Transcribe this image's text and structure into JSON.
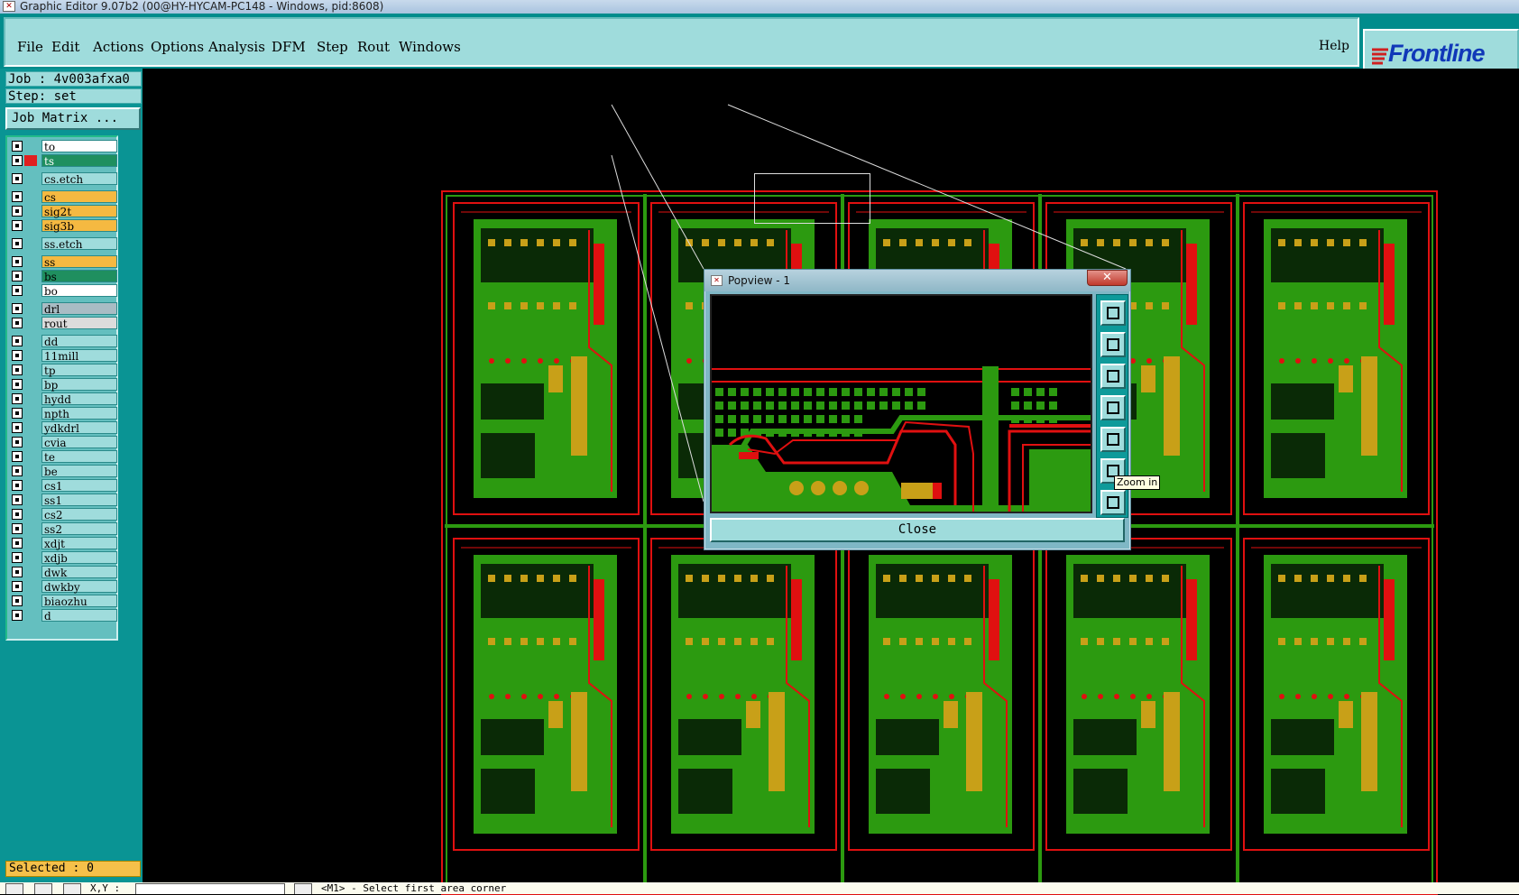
{
  "window": {
    "title": "Graphic Editor 9.07b2 (00@HY-HYCAM-PC148 - Windows, pid:8608)"
  },
  "menu": {
    "items": [
      "File",
      "Edit",
      "Actions",
      "Options",
      "Analysis",
      "DFM",
      "Step",
      "Rout",
      "Windows"
    ],
    "help": "Help"
  },
  "brand": {
    "logo_text": "Frontline"
  },
  "job": {
    "label": "Job : 4v003afxa0",
    "step": "Step: set",
    "matrix_button": "Job Matrix ..."
  },
  "layers": [
    {
      "name": "to",
      "color": "#ffffff"
    },
    {
      "name": "ts",
      "color": "#1f8f5f",
      "active": true
    },
    {
      "name": "cs.etch",
      "color": "#9fdcdc"
    },
    {
      "name": "cs",
      "color": "#f5b941"
    },
    {
      "name": "sig2t",
      "color": "#f5b941"
    },
    {
      "name": "sig3b",
      "color": "#f5b941"
    },
    {
      "name": "ss.etch",
      "color": "#9fdcdc"
    },
    {
      "name": "ss",
      "color": "#f5b941"
    },
    {
      "name": "bs",
      "color": "#1f8f5f"
    },
    {
      "name": "bo",
      "color": "#ffffff"
    },
    {
      "name": "drl",
      "color": "#a9bcc4"
    },
    {
      "name": "rout",
      "color": "#dcdcdc"
    },
    {
      "name": "dd",
      "color": "#9fdcdc"
    },
    {
      "name": "11mill",
      "color": "#9fdcdc"
    },
    {
      "name": "tp",
      "color": "#9fdcdc"
    },
    {
      "name": "bp",
      "color": "#9fdcdc"
    },
    {
      "name": "hydd",
      "color": "#9fdcdc"
    },
    {
      "name": "npth",
      "color": "#9fdcdc"
    },
    {
      "name": "ydkdrl",
      "color": "#9fdcdc"
    },
    {
      "name": "cvia",
      "color": "#9fdcdc"
    },
    {
      "name": "te",
      "color": "#9fdcdc"
    },
    {
      "name": "be",
      "color": "#9fdcdc"
    },
    {
      "name": "cs1",
      "color": "#9fdcdc"
    },
    {
      "name": "ss1",
      "color": "#9fdcdc"
    },
    {
      "name": "cs2",
      "color": "#9fdcdc"
    },
    {
      "name": "ss2",
      "color": "#9fdcdc"
    },
    {
      "name": "xdjt",
      "color": "#9fdcdc"
    },
    {
      "name": "xdjb",
      "color": "#9fdcdc"
    },
    {
      "name": "dwk",
      "color": "#9fdcdc"
    },
    {
      "name": "dwkby",
      "color": "#9fdcdc"
    },
    {
      "name": "biaozhu",
      "color": "#9fdcdc"
    },
    {
      "name": "d",
      "color": "#9fdcdc"
    }
  ],
  "selected": "Selected : 0",
  "popview": {
    "title": "Popview - 1",
    "close_label": "Close",
    "tooltip": "Zoom in",
    "tools": [
      "zoom-window-icon",
      "pan-up-icon",
      "pan-down-icon",
      "pan-left-icon",
      "pan-right-icon",
      "zoom-in-icon",
      "zoom-home-icon"
    ]
  },
  "status": {
    "xy_label": "X,Y :",
    "message": "<M1> - Select first area corner"
  },
  "colors": {
    "copper": "#2c9a10",
    "trace": "#e01010",
    "pad": "#c8a018",
    "background": "#000000"
  }
}
